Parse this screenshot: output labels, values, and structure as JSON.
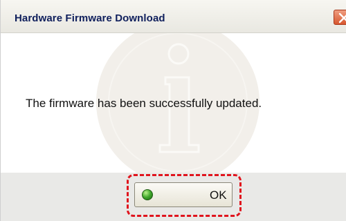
{
  "dialog": {
    "title": "Hardware Firmware Download",
    "message": "The firmware has been successfully updated.",
    "ok_label": "OK"
  },
  "icons": {
    "close": "close-icon",
    "info_watermark": "info-watermark-icon",
    "ok": "green-check-orb-icon"
  },
  "colors": {
    "title_text": "#0f1f5c",
    "close_button": "#d7572f",
    "highlight": "#e0141d",
    "ok_icon": "#3fa62b"
  }
}
